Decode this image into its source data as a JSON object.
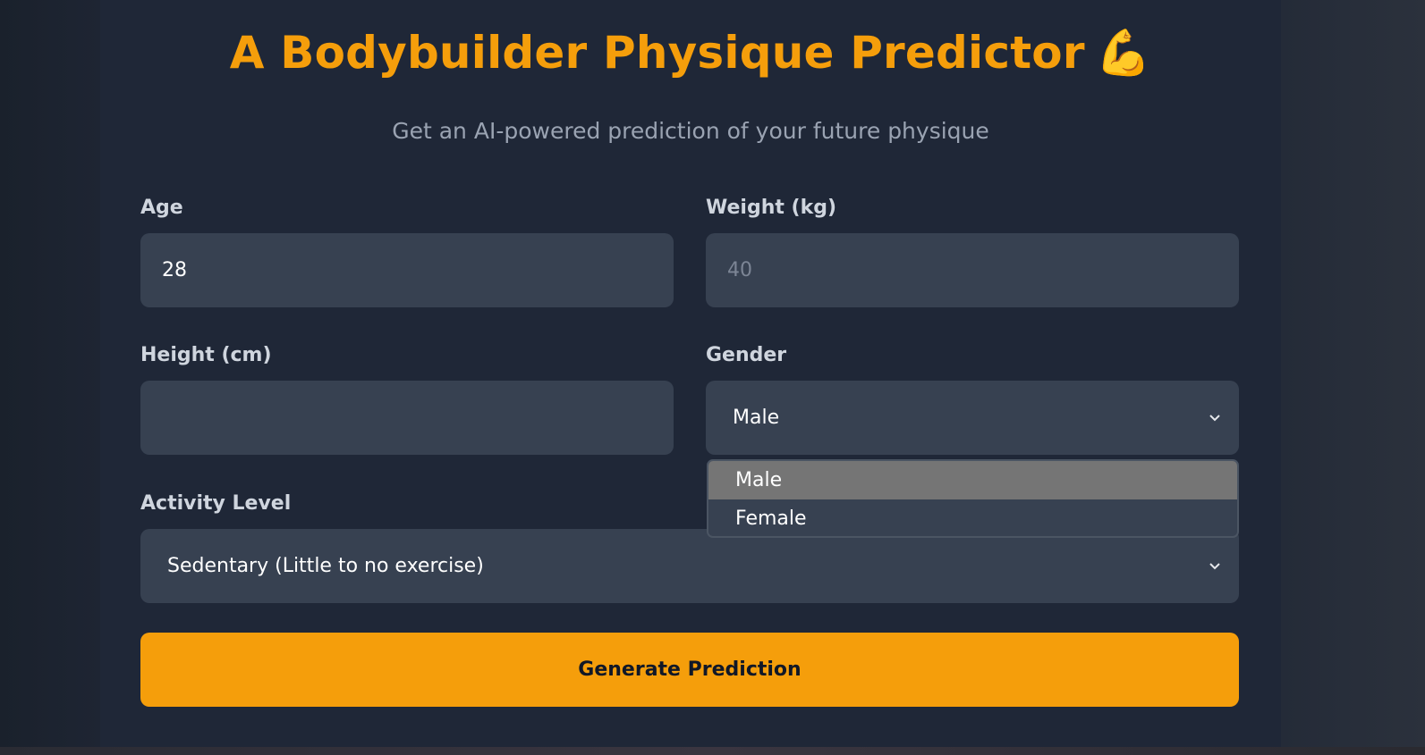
{
  "header": {
    "title": "A Bodybuilder Physique Predictor",
    "title_emoji": "💪",
    "subtitle": "Get an AI-powered prediction of your future physique"
  },
  "form": {
    "age": {
      "label": "Age",
      "value": "28"
    },
    "weight": {
      "label": "Weight (kg)",
      "placeholder": "40"
    },
    "height": {
      "label": "Height (cm)",
      "value": ""
    },
    "gender": {
      "label": "Gender",
      "selected": "Male",
      "options": [
        "Male",
        "Female"
      ]
    },
    "activity": {
      "label": "Activity Level",
      "selected": "Sedentary (Little to no exercise)"
    },
    "submit_label": "Generate Prediction"
  },
  "colors": {
    "accent": "#f59e0b",
    "background": "#1f2737",
    "field": "#374151",
    "option_highlight": "#757575"
  },
  "icons": {
    "title": "flexed-biceps-icon",
    "select": "chevron-down-icon"
  }
}
